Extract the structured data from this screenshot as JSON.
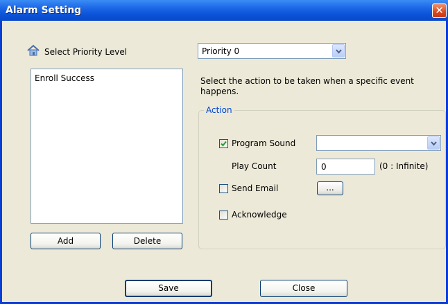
{
  "window": {
    "title": "Alarm Setting",
    "close_glyph": "✕"
  },
  "priority": {
    "label": "Select Priority Level",
    "icon": "house-icon",
    "selected": "Priority 0"
  },
  "events": {
    "items": [
      "Enroll Success"
    ],
    "add_label": "Add",
    "delete_label": "Delete"
  },
  "description": "Select the action to be taken when a specific event happens.",
  "action": {
    "group_label": "Action",
    "program_sound": {
      "label": "Program Sound",
      "checked": true,
      "selected": ""
    },
    "play_count": {
      "label": "Play Count",
      "value": "0",
      "hint": "(0 : Infinite)"
    },
    "send_email": {
      "label": "Send Email",
      "checked": false,
      "button_label": "..."
    },
    "acknowledge": {
      "label": "Acknowledge",
      "checked": false
    }
  },
  "footer": {
    "save_label": "Save",
    "close_label": "Close"
  },
  "colors": {
    "title_bar": "#0b53d8",
    "dialog_bg": "#ece9d8",
    "group_label": "#0046d5",
    "close_button": "#d9481f"
  }
}
